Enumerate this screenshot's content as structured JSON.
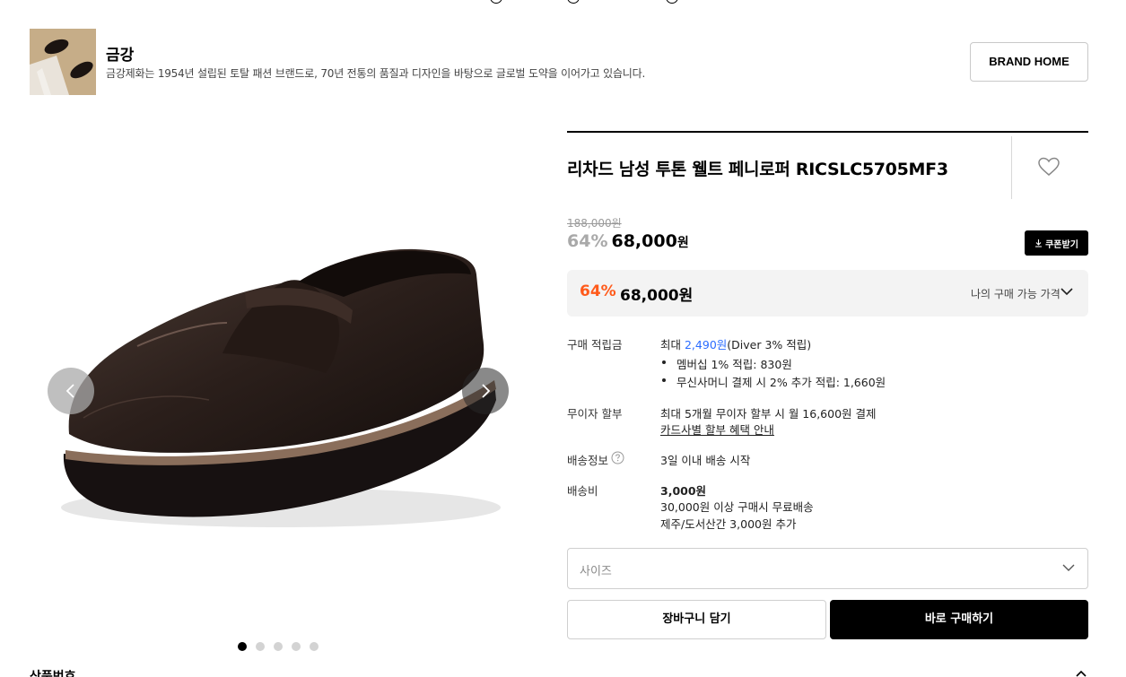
{
  "brand": {
    "name": "금강",
    "description": "금강제화는 1954년 설립된 토탈 패션 브랜드로, 70년 전통의 품질과 디자인을 바탕으로 글로벌 도약을 이어가고 있습니다.",
    "home_button": "BRAND HOME"
  },
  "gallery": {
    "slide_count": 5,
    "active_index": 0,
    "icons": {
      "prev": "chevron-left-icon",
      "next": "chevron-right-icon"
    }
  },
  "product": {
    "title": "리차드 남성 투톤 웰트 페니로퍼 RICSLC5705MF3",
    "original_price": "188,000원",
    "discount": "64%",
    "price": "68,000",
    "price_unit": "원",
    "coupon_label": "쿠폰받기",
    "my_price": {
      "discount": "64%",
      "price": "68,000원",
      "label": "나의 구매 가능 가격"
    }
  },
  "info": {
    "points_label": "구매 적립금",
    "points_prefix": "최대 ",
    "points_amount": "2,490원",
    "points_suffix": "(Diver 3% 적립)",
    "points_items": [
      "멤버십 1% 적립: 830원",
      "무신사머니 결제 시 2% 추가 적립: 1,660원"
    ],
    "installment_label": "무이자 할부",
    "installment_text": "최대 5개월 무이자 할부 시 월 16,600원 결제",
    "installment_link": "카드사별 할부 혜택 안내",
    "shipping_label": "배송정보",
    "shipping_text": "3일 이내 배송 시작",
    "fee_label": "배송비",
    "fee_amount": "3,000원",
    "fee_free": "30,000원 이상 구매시 무료배송",
    "fee_extra": "제주/도서산간 3,000원 추가"
  },
  "purchase": {
    "size_placeholder": "사이즈",
    "cart_button": "장바구니 담기",
    "buy_button": "바로 구매하기"
  },
  "below": {
    "section_title": "상품번호"
  },
  "colors": {
    "accent_discount": "#ff5a1a",
    "link_blue": "#2b6cff",
    "primary_button": "#000000"
  }
}
